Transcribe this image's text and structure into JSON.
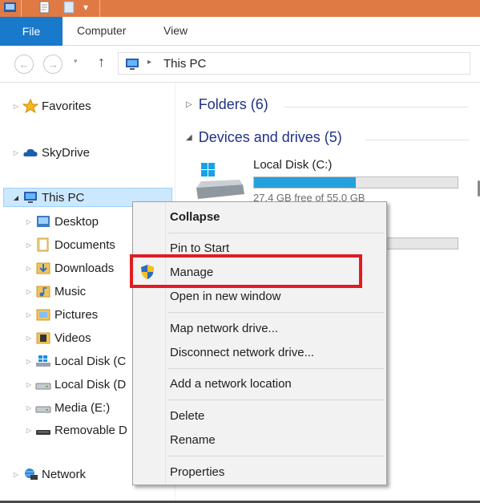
{
  "ribbon": {
    "tabs": [
      "File",
      "Computer",
      "View"
    ]
  },
  "address": {
    "path": "This PC",
    "back_icon": "back-arrow-icon",
    "forward_icon": "forward-arrow-icon",
    "up_icon": "up-arrow-icon"
  },
  "nav": {
    "favorites": "Favorites",
    "skydrive": "SkyDrive",
    "this_pc": "This PC",
    "children": [
      "Desktop",
      "Documents",
      "Downloads",
      "Music",
      "Pictures",
      "Videos",
      "Local Disk (C",
      "Local Disk (D",
      "Media (E:)",
      "Removable D"
    ],
    "network": "Network"
  },
  "content": {
    "folders_group": "Folders (6)",
    "devices_group": "Devices and drives (5)",
    "drive_c": {
      "label": "Local Disk (C:)",
      "free": "27.4 GB free of 55.0 GB",
      "used_fraction": 0.5
    },
    "drive_d": {
      "used_fraction": 0.0
    }
  },
  "context_menu": {
    "collapse": "Collapse",
    "pin_to_start": "Pin to Start",
    "manage": "Manage",
    "open_new_window": "Open in new window",
    "map_drive": "Map network drive...",
    "disconnect_drive": "Disconnect network drive...",
    "add_location": "Add a network location",
    "delete": "Delete",
    "rename": "Rename",
    "properties": "Properties"
  },
  "colors": {
    "title_bar": "#e07a44",
    "file_tab": "#1979ca",
    "highlight": "#e01c23",
    "drive_fill": "#26a0da",
    "group_title": "#1e3287"
  }
}
